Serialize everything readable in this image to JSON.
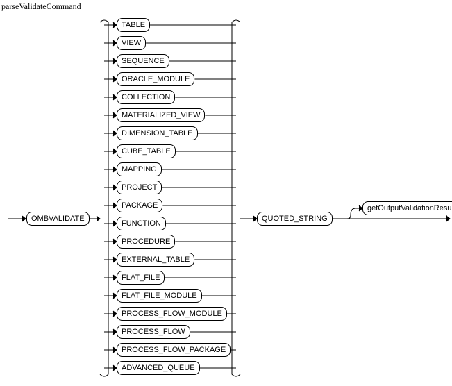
{
  "title": "parseValidateCommand",
  "chart_data": {
    "type": "railroad-syntax-diagram",
    "rule": "parseValidateCommand",
    "sequence": [
      "OMBVALIDATE",
      "<choice>",
      "QUOTED_STRING",
      "getOutputValidationResults"
    ],
    "choice_options": [
      "TABLE",
      "VIEW",
      "SEQUENCE",
      "ORACLE_MODULE",
      "COLLECTION",
      "MATERIALIZED_VIEW",
      "DIMENSION_TABLE",
      "CUBE_TABLE",
      "MAPPING",
      "PROJECT",
      "PACKAGE",
      "FUNCTION",
      "PROCEDURE",
      "EXTERNAL_TABLE",
      "FLAT_FILE",
      "FLAT_FILE_MODULE",
      "PROCESS_FLOW_MODULE",
      "PROCESS_FLOW",
      "PROCESS_FLOW_PACKAGE",
      "ADVANCED_QUEUE"
    ]
  },
  "start": "OMBVALIDATE",
  "options": {
    "o0": "TABLE",
    "o1": "VIEW",
    "o2": "SEQUENCE",
    "o3": "ORACLE_MODULE",
    "o4": "COLLECTION",
    "o5": "MATERIALIZED_VIEW",
    "o6": "DIMENSION_TABLE",
    "o7": "CUBE_TABLE",
    "o8": "MAPPING",
    "o9": "PROJECT",
    "o10": "PACKAGE",
    "o11": "FUNCTION",
    "o12": "PROCEDURE",
    "o13": "EXTERNAL_TABLE",
    "o14": "FLAT_FILE",
    "o15": "FLAT_FILE_MODULE",
    "o16": "PROCESS_FLOW_MODULE",
    "o17": "PROCESS_FLOW",
    "o18": "PROCESS_FLOW_PACKAGE",
    "o19": "ADVANCED_QUEUE"
  },
  "after1": "QUOTED_STRING",
  "after2": "getOutputValidationResults"
}
